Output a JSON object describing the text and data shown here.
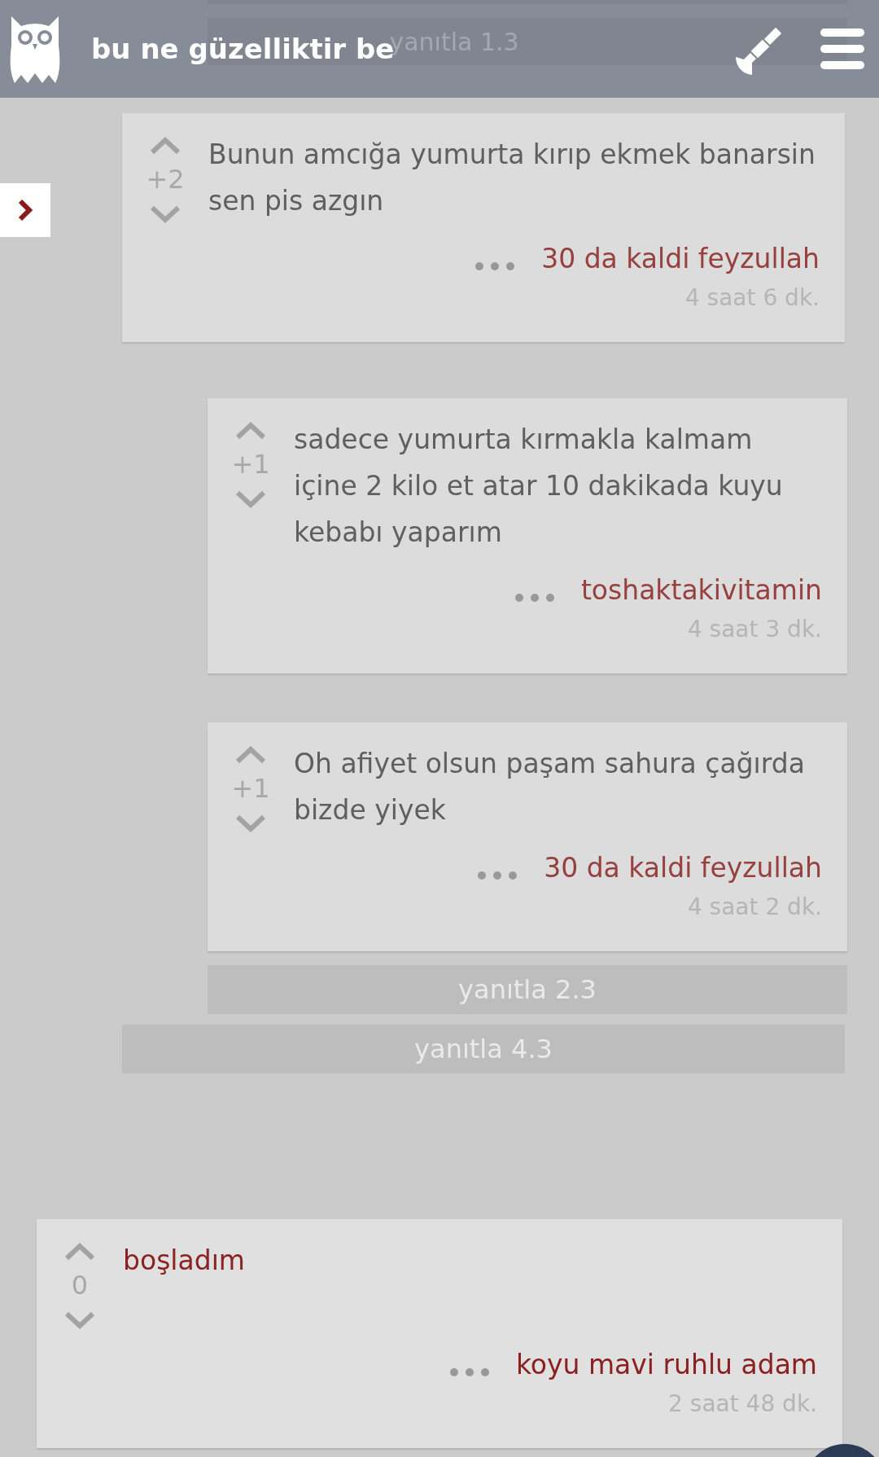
{
  "header": {
    "title": "bu ne güzelliktir be",
    "behind_reply": "yanıtla 1.3"
  },
  "thread": {
    "children": [
      {
        "kind": "reply",
        "score": "+2",
        "text": "Bunun amcığa yumurta kırıp ekmek banarsin sen pis azgın",
        "author": "30 da kaldi feyzullah",
        "time": "4 saat 6 dk.",
        "reply_label": "yanıtla 2.3",
        "children": [
          {
            "kind": "reply",
            "score": "+1",
            "text": "sadece yumurta kırmakla kalmam içine 2 kilo et atar 10 dakikada kuyu kebabı yaparım",
            "author": "toshaktakivitamin",
            "time": "4 saat 3 dk."
          },
          {
            "kind": "reply",
            "score": "+1",
            "text": "Oh afiyet olsun paşam sahura çağırda bizde yiyek",
            "author": "30 da kaldi feyzullah",
            "time": "4 saat 2 dk."
          }
        ]
      }
    ],
    "reply_label": "yanıtla 4.3"
  },
  "comments": [
    {
      "kind": "topic",
      "score": "0",
      "text": "boşladım",
      "author": "koyu mavi ruhlu adam",
      "time": "2 saat 48 dk."
    }
  ]
}
